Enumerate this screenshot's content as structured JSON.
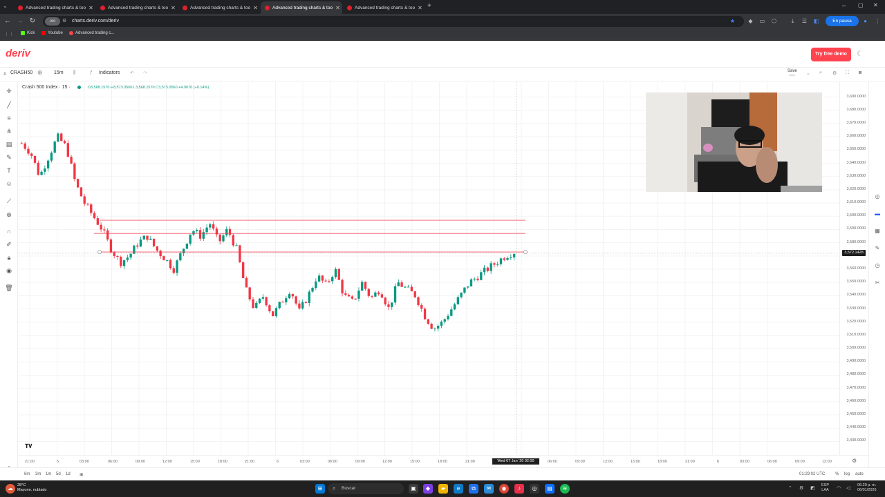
{
  "browser": {
    "tabs": [
      {
        "title": "Advanced trading charts & too",
        "active": false
      },
      {
        "title": "Advanced trading charts & too",
        "active": false
      },
      {
        "title": "Advanced trading charts & too",
        "active": false
      },
      {
        "title": "Advanced trading charts & too",
        "active": true
      },
      {
        "title": "Advanced trading charts & too",
        "active": false
      }
    ],
    "url": "charts.deriv.com/deriv",
    "guest_label": "uro",
    "profile_status": "En pausa",
    "bookmarks": [
      {
        "label": "Kick",
        "color": "#53fc18"
      },
      {
        "label": "Youtube",
        "color": "#ff0000"
      },
      {
        "label": "Advanced trading c...",
        "color": "#ff444f"
      }
    ]
  },
  "app": {
    "logo": "deriv",
    "cta_label": "Try free demo",
    "accent": "#ff444f"
  },
  "toolbar": {
    "symbol": "CRASH50",
    "interval": "15m",
    "indicators_label": "Indicators",
    "save_label": "Save",
    "save_sub": "Save"
  },
  "legend": {
    "title": "Crash 500 Index · 15 ·",
    "ohlc": "O3,568.1570  H3,573.0560  L3,568.1570  C3,573.0560  +4.9070 (+0.14%)"
  },
  "chart_data": {
    "type": "candlestick",
    "symbol": "Crash 500 Index",
    "interval": "15",
    "price_axis": [
      "3,690.0000",
      "3,680.0000",
      "3,670.0000",
      "3,660.0000",
      "3,650.0000",
      "3,640.0000",
      "3,630.0000",
      "3,620.0000",
      "3,610.0000",
      "3,600.0000",
      "3,590.0000",
      "3,580.0000",
      "3,570.0000",
      "3,560.0000",
      "3,550.0000",
      "3,540.0000",
      "3,530.0000",
      "3,520.0000",
      "3,510.0000",
      "3,500.0000",
      "3,490.0000",
      "3,480.0000",
      "3,470.0000",
      "3,460.0000",
      "3,450.0000",
      "3,440.0000",
      "3,430.0000"
    ],
    "ylim": [
      3425,
      3695
    ],
    "time_axis": [
      "21:00",
      "5",
      "03:00",
      "06:00",
      "09:00",
      "12:00",
      "15:00",
      "18:00",
      "21:00",
      "6",
      "03:00",
      "06:00",
      "09:00",
      "12:00",
      "15:00",
      "18:00",
      "21:00",
      "06:00",
      "09:00",
      "12:00",
      "15:00",
      "18:00",
      "21:00",
      "6",
      "03:00",
      "06:00",
      "09:00",
      "12:00"
    ],
    "current_price": "3,572.1428",
    "crosshair_date": "Wed 07 Jan '26  02:00",
    "horizontal_lines": [
      3597.0,
      3587.0,
      3573.0
    ],
    "price_path": [
      3655,
      3648,
      3630,
      3645,
      3660,
      3652,
      3625,
      3610,
      3600,
      3590,
      3575,
      3565,
      3570,
      3580,
      3585,
      3575,
      3568,
      3560,
      3575,
      3590,
      3585,
      3595,
      3580,
      3590,
      3575,
      3545,
      3530,
      3540,
      3525,
      3535,
      3545,
      3528,
      3540,
      3555,
      3548,
      3560,
      3540,
      3535,
      3550,
      3538,
      3545,
      3530,
      3550,
      3545,
      3540,
      3525,
      3515,
      3520,
      3530,
      3540,
      3550,
      3555,
      3560,
      3565,
      3570,
      3573
    ],
    "up_color": "#089981",
    "down_color": "#f23645",
    "line_color": "#f23645"
  },
  "bottom": {
    "ranges": [
      "6m",
      "3m",
      "1m",
      "5d",
      "1d"
    ],
    "clock": "01:29:02 UTC",
    "percent": "%",
    "log": "log",
    "auto": "auto"
  },
  "taskbar": {
    "weather_temp": "28°C",
    "weather_desc": "Mayorm. nublado",
    "search_placeholder": "Buscar",
    "lang": "ESP",
    "lang2": "LAA",
    "time": "06:29 p. m.",
    "date": "06/01/2026"
  }
}
